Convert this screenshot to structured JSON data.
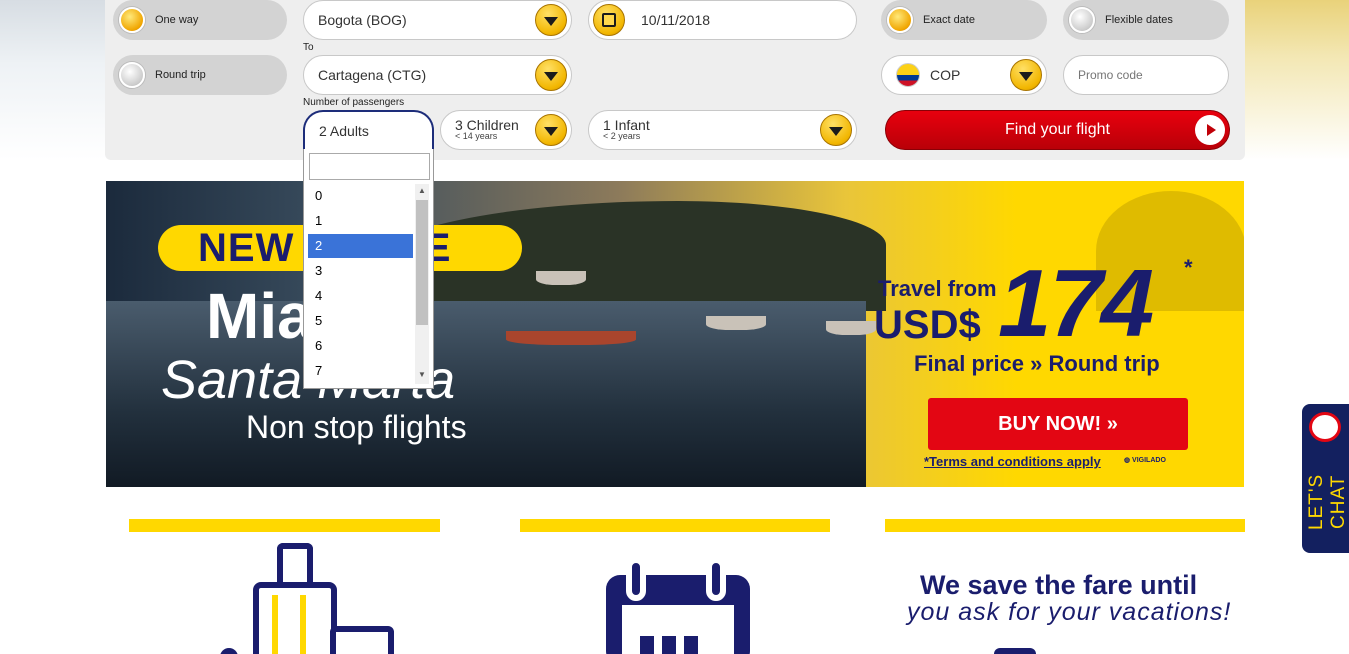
{
  "trip_type": {
    "one_way": "One way",
    "round_trip": "Round trip"
  },
  "search": {
    "origin": "Bogota (BOG)",
    "to_label": "To",
    "destination": "Cartagena (CTG)",
    "date": "10/11/2018",
    "passengers_label": "Number of passengers",
    "adults": "2 Adults",
    "children": "3 Children",
    "children_sub": "< 14 years",
    "infant": "1 Infant",
    "infant_sub": "< 2 years"
  },
  "date_options": {
    "exact": "Exact date",
    "flexible": "Flexible dates"
  },
  "currency": "COP",
  "promo": {
    "placeholder": "Promo code"
  },
  "find_button": "Find your flight",
  "adults_dropdown": {
    "options": [
      "0",
      "1",
      "2",
      "3",
      "4",
      "5",
      "6",
      "7"
    ],
    "selected": "2"
  },
  "banner": {
    "tag": "NEW ROUTE",
    "city1": "Miami",
    "city2": "Santa Marta",
    "subtitle": "Non stop flights",
    "travel_from": "Travel from",
    "currency": "USD$",
    "price": "174",
    "asterisk": "*",
    "final": "Final price » Round trip",
    "cta": "BUY NOW! »",
    "terms": "*Terms and conditions apply",
    "logo": "VIGILADO SUPERTRANSPORTE"
  },
  "features": {
    "save_line1": "We save the fare until",
    "save_line2": "you ask for your vacations!"
  },
  "chat": {
    "label": "LET'S CHAT"
  },
  "colors": {
    "brand_navy": "#1a1d6d",
    "brand_yellow": "#ffd800",
    "brand_red": "#e30613"
  }
}
